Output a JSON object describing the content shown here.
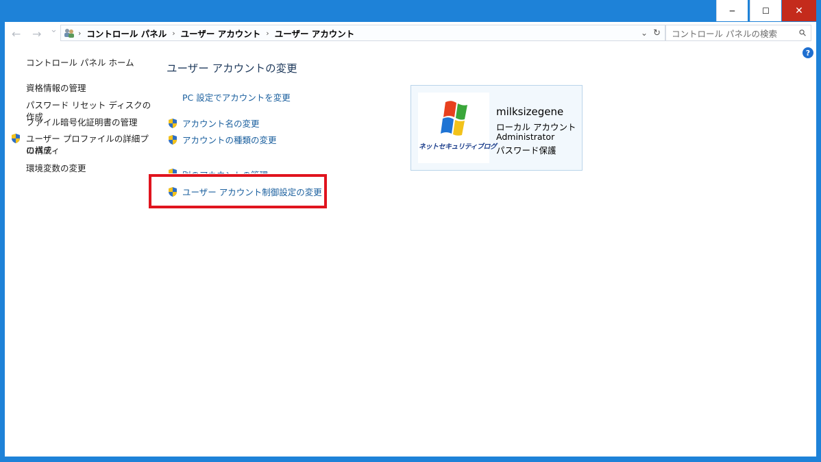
{
  "window": {
    "minimize_glyph": "‒",
    "maximize_glyph": "☐",
    "close_glyph": "✕"
  },
  "nav": {
    "back_glyph": "←",
    "forward_glyph": "→",
    "recent_glyph": "⌄",
    "breadcrumbs": [
      "コントロール パネル",
      "ユーザー アカウント",
      "ユーザー アカウント"
    ],
    "sep_glyph": "›",
    "dropdown_glyph": "⌄",
    "refresh_glyph": "↻",
    "search_placeholder": "コントロール パネルの検索",
    "search_glyph": "⚲"
  },
  "left_pane": {
    "home": "コントロール パネル ホーム",
    "items": [
      "資格情報の管理",
      "パスワード リセット ディスクの作成",
      "ファイル暗号化証明書の管理",
      "ユーザー プロファイルの詳細プロパティ",
      "の構成",
      "環境変数の変更"
    ]
  },
  "main": {
    "title": "ユーザー アカウントの変更",
    "links": [
      "PC 設定でアカウントを変更",
      "アカウント名の変更",
      "アカウントの種類の変更",
      "別のアカウントの管理",
      "ユーザー アカウント制御設定の変更"
    ]
  },
  "user": {
    "name": "milksizegene",
    "type": "ローカル アカウント",
    "role": "Administrator",
    "password": "パスワード保護",
    "avatar_text": "ネットセキュリティブログ"
  },
  "help_glyph": "?",
  "colors": {
    "frame": "#1e82d8",
    "link": "#1a5f9e",
    "highlight": "#e0141e",
    "close": "#c42b1c"
  }
}
